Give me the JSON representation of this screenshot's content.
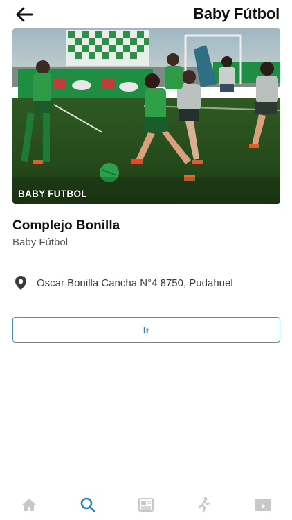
{
  "header": {
    "title": "Baby Fútbol",
    "back_icon": "arrow-left-icon"
  },
  "hero": {
    "caption": "BABY FUTBOL"
  },
  "place": {
    "name": "Complejo Bonilla",
    "category": "Baby Fútbol",
    "address": "Oscar Bonilla Cancha N°4 8750, Pudahuel",
    "address_icon": "map-pin-icon"
  },
  "actions": {
    "go_label": "Ir"
  },
  "tabbar": {
    "items": [
      {
        "icon": "home-icon",
        "active": false
      },
      {
        "icon": "search-icon",
        "active": true
      },
      {
        "icon": "news-icon",
        "active": false
      },
      {
        "icon": "running-person-icon",
        "active": false
      },
      {
        "icon": "video-icon",
        "active": false
      }
    ]
  },
  "colors": {
    "accent": "#2f7fb3",
    "inactive_icon": "#c8c8c8",
    "text_primary": "#111111",
    "text_secondary": "#555555"
  }
}
